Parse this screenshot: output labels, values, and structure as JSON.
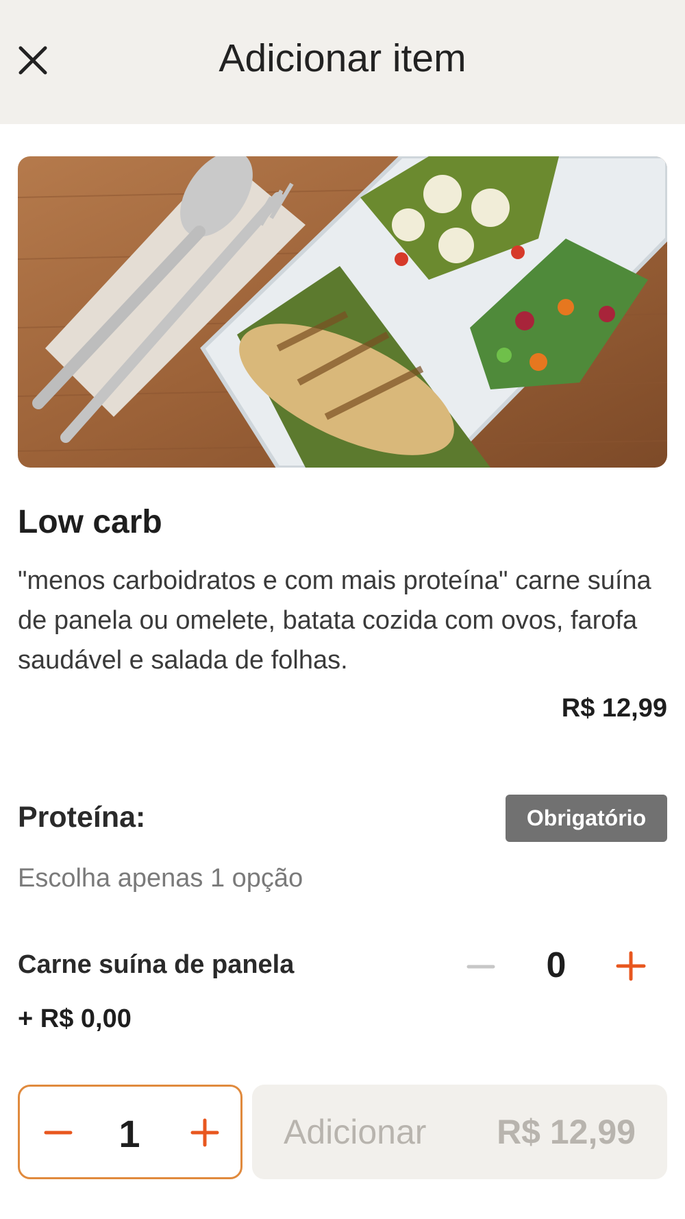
{
  "header": {
    "title": "Adicionar item"
  },
  "item": {
    "name": "Low carb",
    "description": "\"menos carboidratos e com mais proteína\" carne suína de panela ou omelete, batata cozida com ovos, farofa saudável e salada de folhas.",
    "price": "R$ 12,99"
  },
  "section": {
    "title": "Proteína:",
    "badge": "Obrigatório",
    "subtitle": "Escolha apenas 1 opção"
  },
  "options": [
    {
      "label": "Carne suína de panela",
      "count": "0",
      "price": "+ R$ 0,00"
    }
  ],
  "footer": {
    "quantity": "1",
    "add_label": "Adicionar",
    "add_price": "R$ 12,99"
  },
  "colors": {
    "accent": "#e8571f",
    "header_bg": "#f2f0ec",
    "badge_bg": "#717171",
    "qty_border": "#e08a3d",
    "disabled_text": "#b8b4ae"
  },
  "icons": {
    "close": "close-icon",
    "minus": "minus-icon",
    "plus": "plus-icon"
  }
}
